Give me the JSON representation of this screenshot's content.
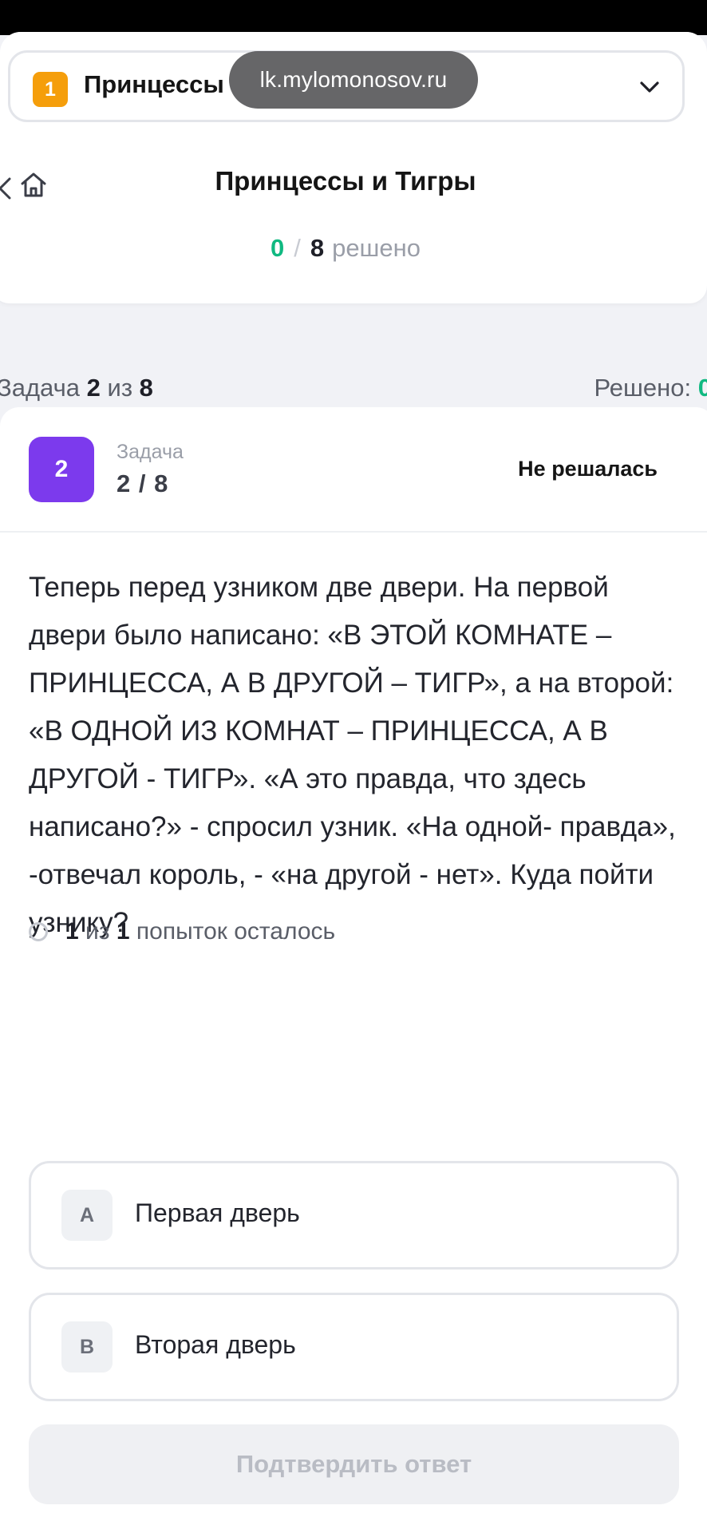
{
  "browser": {
    "url": "lk.mylomonosov.ru"
  },
  "task_selector": {
    "number": "1",
    "title": "Принцессы"
  },
  "header": {
    "title": "Принцессы и Тигры",
    "solved": "0",
    "separator": "/",
    "total": "8",
    "solved_word": "решено"
  },
  "counter": {
    "task_word": "Задача",
    "current": "2",
    "of_word": "из",
    "total": "8",
    "solved_label": "Решено:",
    "solved_value": "0"
  },
  "task": {
    "number": "2",
    "label": "Задача",
    "fraction": "2 / 8",
    "status": "Не решалась",
    "question": "Теперь перед узником две двери. На первой двери было написано: «В ЭТОЙ КОМНАТЕ – ПРИНЦЕССА, А В ДРУГОЙ – ТИГР», а на второй: «В ОДНОЙ ИЗ КОМНАТ – ПРИНЦЕССА, А В ДРУГОЙ - ТИГР». «А это правда, что здесь написано?» - спросил узник. «На одной- правда», -отвечал король, - «на другой - нет». Куда пойти узнику?",
    "attempts": {
      "left": "1",
      "of_word": "из",
      "total": "1",
      "suffix": "попыток осталось"
    },
    "options": [
      {
        "letter": "A",
        "text": "Первая дверь"
      },
      {
        "letter": "B",
        "text": "Вторая дверь"
      }
    ],
    "submit_label": "Подтвердить ответ"
  },
  "colors": {
    "accent_purple": "#7c3aed",
    "badge_orange": "#f59e0b",
    "solved_green": "#10b981"
  },
  "icons": {
    "back": "chevron-left-icon",
    "home": "home-icon",
    "dropdown": "chevron-down-icon",
    "radio": "radio-empty-icon"
  }
}
